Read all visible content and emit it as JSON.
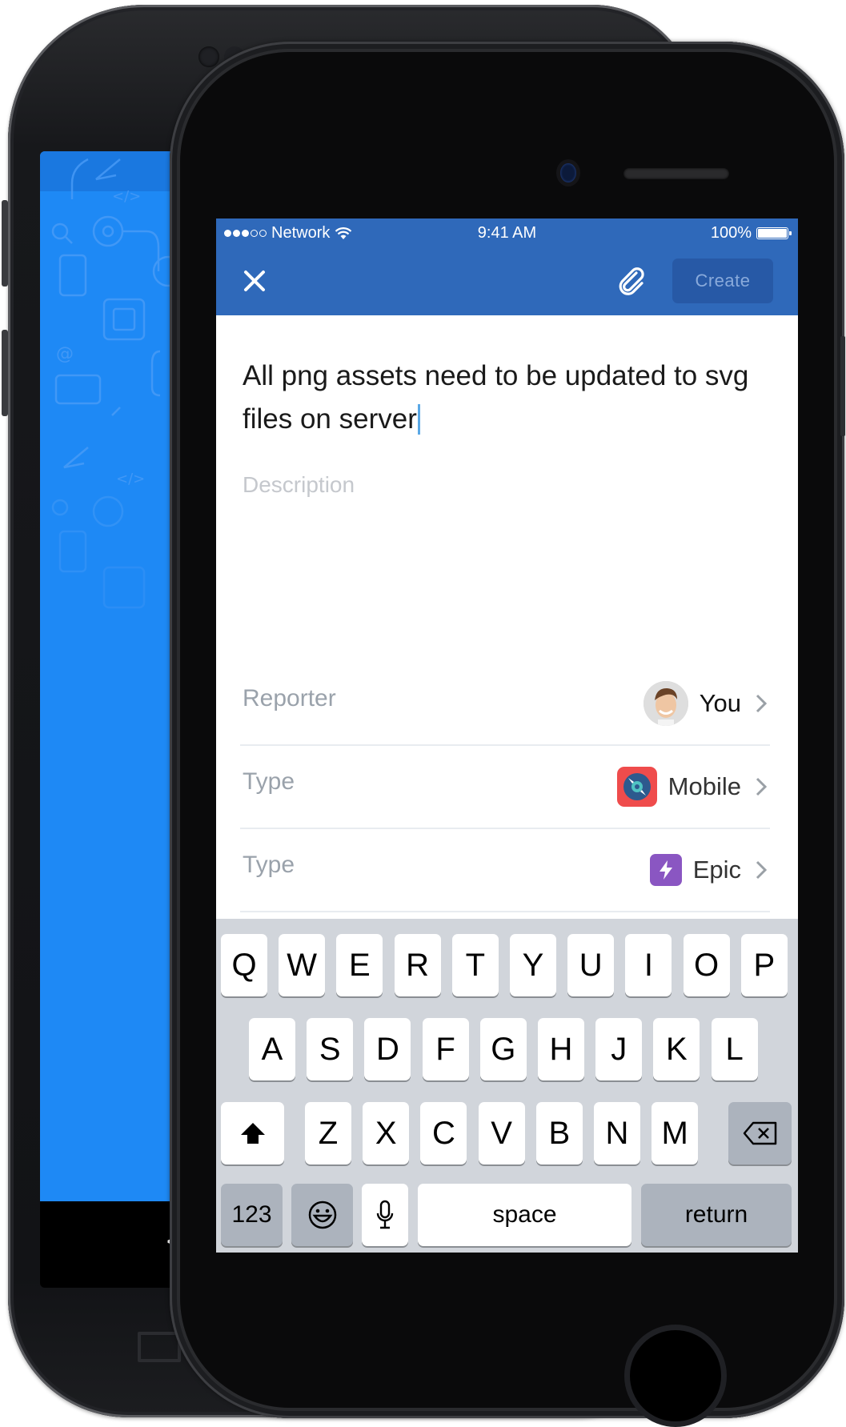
{
  "status_bar": {
    "signal_filled": 3,
    "signal_total": 5,
    "carrier": "Network",
    "time": "9:41 AM",
    "battery_text": "100%",
    "battery_level": 1.0
  },
  "nav": {
    "close_icon": "close-icon",
    "attach_icon": "paperclip-icon",
    "create_label": "Create"
  },
  "issue": {
    "title": "All png assets need to be updated to svg files on server",
    "description_placeholder": "Description"
  },
  "fields": [
    {
      "label": "Reporter",
      "value": "You",
      "icon": "user-avatar"
    },
    {
      "label": "Type",
      "value": "Mobile",
      "icon": "mobile-type-icon"
    },
    {
      "label": "Type",
      "value": "Epic",
      "icon": "epic-lightning-icon"
    }
  ],
  "keyboard": {
    "row1": [
      "Q",
      "W",
      "E",
      "R",
      "T",
      "Y",
      "U",
      "I",
      "O",
      "P"
    ],
    "row2": [
      "A",
      "S",
      "D",
      "F",
      "G",
      "H",
      "J",
      "K",
      "L"
    ],
    "row3": [
      "Z",
      "X",
      "C",
      "V",
      "B",
      "N",
      "M"
    ],
    "numbers_label": "123",
    "space_label": "space",
    "return_label": "return"
  },
  "colors": {
    "brand_blue": "#2f69ba",
    "create_button_bg": "#2759a6",
    "back_screen_blue": "#1e89f5",
    "cursor": "#5aa8e6",
    "mobile_tile": "#ef4c4c",
    "epic_tile": "#8a56c2"
  },
  "back_device": {
    "nav_back_glyph": "<"
  }
}
